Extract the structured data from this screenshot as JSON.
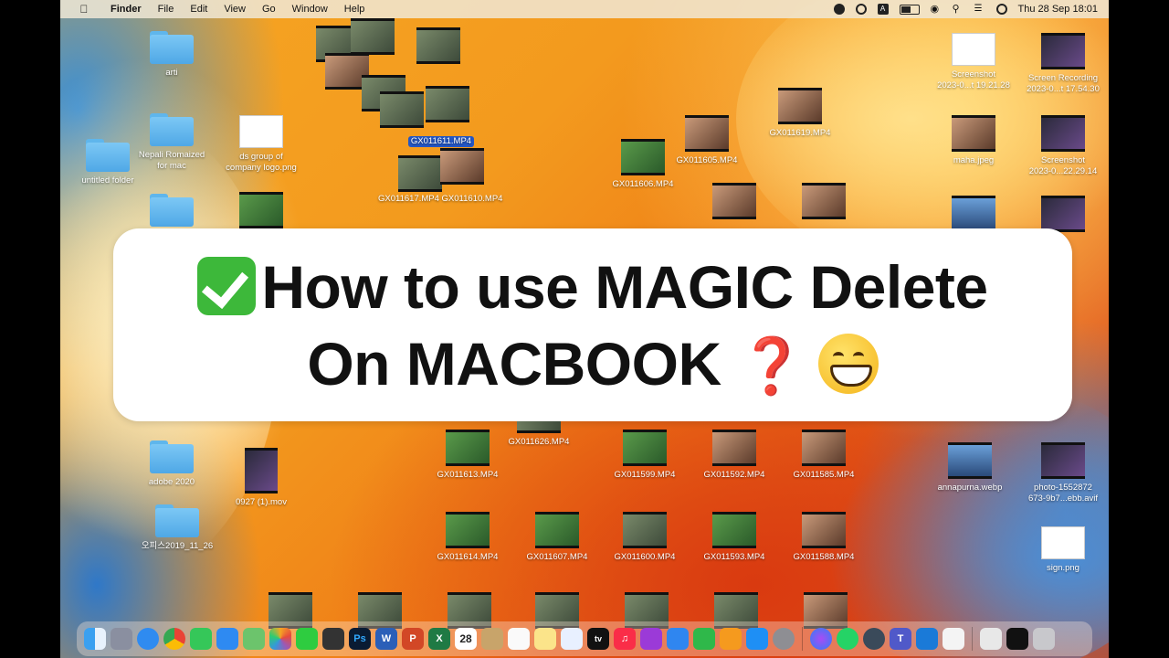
{
  "menubar": {
    "app": "Finder",
    "menus": [
      "File",
      "Edit",
      "View",
      "Go",
      "Window",
      "Help"
    ],
    "input_badge": "A",
    "clock": "Thu 28 Sep  18:01"
  },
  "desktop_left": [
    {
      "label": "arti"
    },
    {
      "label": "Nepali Romaized\nfor mac"
    },
    {
      "label": "ds group of\ncompany logo.png"
    },
    {
      "label": "untitled folder"
    },
    {
      "label": "adobe 2020"
    },
    {
      "label": "0927 (1).mov"
    },
    {
      "label": "오피스2019_11_26"
    }
  ],
  "banner": {
    "line1": "How to use MAGIC Delete",
    "line2": "On MACBOOK"
  },
  "desktop_right": [
    {
      "label": "Screenshot\n2023-0...t 19.21.28"
    },
    {
      "label": "Screen Recording\n2023-0...t 17.54.30"
    },
    {
      "label": "maha.jpeg"
    },
    {
      "label": "Screenshot\n2023-0...22.29.14"
    },
    {
      "label": "annapurna.webp"
    },
    {
      "label": "photo-1552872\n673-9b7...ebb.avif"
    },
    {
      "label": "sign.png"
    }
  ],
  "videos": [
    {
      "label": "GX011611.MP4",
      "selected": true
    },
    {
      "label": "GX011619.MP4"
    },
    {
      "label": "GX011605.MP4"
    },
    {
      "label": "GX011606.MP4"
    },
    {
      "label": "GX011617.MP4"
    },
    {
      "label": "GX011610.MP4"
    },
    {
      "label": "GX011626.MP4"
    },
    {
      "label": "GX011613.MP4"
    },
    {
      "label": "GX011599.MP4"
    },
    {
      "label": "GX011592.MP4"
    },
    {
      "label": "GX011585.MP4"
    },
    {
      "label": "GX011614.MP4"
    },
    {
      "label": "GX011607.MP4"
    },
    {
      "label": "GX011600.MP4"
    },
    {
      "label": "GX011593.MP4"
    },
    {
      "label": "GX011588.MP4"
    }
  ],
  "dock": {
    "apps": [
      "finder",
      "launchpad",
      "safari",
      "chrome",
      "messages",
      "mail",
      "maps",
      "photos",
      "facetime",
      "final-cut",
      "photoshop",
      "word",
      "powerpoint",
      "excel",
      "calendar",
      "notes-app",
      "reminders",
      "notes",
      "freeform",
      "apple-tv",
      "music",
      "podcasts",
      "keynote",
      "numbers",
      "pages",
      "app-store",
      "system-settings",
      "messenger",
      "whatsapp",
      "quicktime",
      "teams",
      "xcode-tool",
      "textedit",
      "documents",
      "terminal",
      "trash"
    ],
    "calendar_day": "28"
  },
  "colors": {
    "selection": "#2457c5",
    "check": "#3db83a",
    "question": "#e02020"
  }
}
